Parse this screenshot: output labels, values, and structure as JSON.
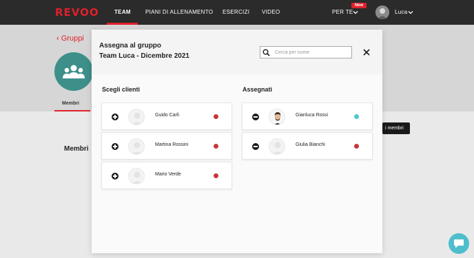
{
  "app": {
    "logo": "REVOO"
  },
  "nav": {
    "items": [
      {
        "label": "TEAM"
      },
      {
        "label": "PIANI DI ALLENAMENTO"
      },
      {
        "label": "ESERCIZI"
      },
      {
        "label": "VIDEO"
      }
    ],
    "per_te": "PER TE",
    "new_badge": "New",
    "user_name": "Luca"
  },
  "page": {
    "back_label": "Gruppi",
    "tab_members": "Membri",
    "members_title": "Membri",
    "add_members_label": "i membri"
  },
  "modal": {
    "title_line1": "Assegna al gruppo",
    "title_line2": "Team Luca - Dicembre 2021",
    "search_placeholder": "Cerca per nome",
    "left_column_title": "Scegli clienti",
    "right_column_title": "Assegnati",
    "clients": [
      {
        "name": "Guido Carli",
        "status_color": "#c8353b"
      },
      {
        "name": "Martina Rossini",
        "status_color": "#c8353b"
      },
      {
        "name": "Mario Verde",
        "status_color": "#c8353b"
      }
    ],
    "assigned": [
      {
        "name": "Gianluca Rossi",
        "status_color": "#4fc7d0",
        "has_photo": true
      },
      {
        "name": "Giulia Bianchi",
        "status_color": "#c8353b",
        "has_photo": false
      }
    ]
  },
  "colors": {
    "brand_red": "#e0202a",
    "topbar": "#2b2b2b",
    "group_avatar": "#3d8f8a",
    "chat_button": "#4fbecc"
  },
  "icons": [
    "search-icon",
    "close-icon",
    "chevron-left-icon",
    "chevron-down-icon",
    "plus-circle-icon",
    "minus-circle-icon",
    "group-icon",
    "chat-icon",
    "user-placeholder-icon"
  ]
}
